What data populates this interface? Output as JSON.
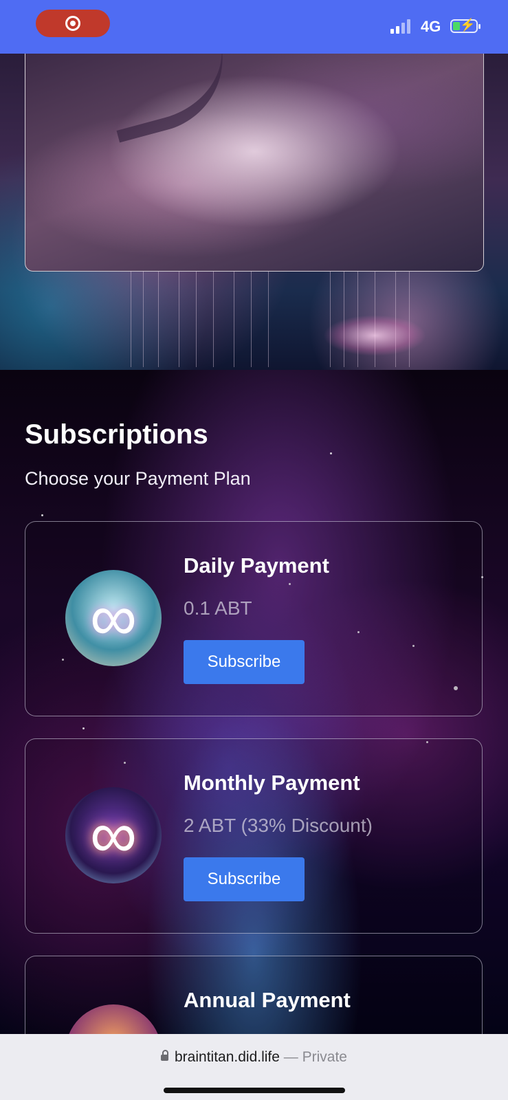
{
  "status_bar": {
    "network": "4G",
    "signal_bars": 2,
    "battery_charging": true,
    "record_icon": "record-icon",
    "battery_icon": "battery-charging-icon"
  },
  "subscriptions": {
    "title": "Subscriptions",
    "subtitle": "Choose your Payment Plan",
    "plans": [
      {
        "name": "Daily Payment",
        "price": "0.1 ABT",
        "button": "Subscribe",
        "icon": "infinity-icon"
      },
      {
        "name": "Monthly Payment",
        "price": "2 ABT (33% Discount)",
        "button": "Subscribe",
        "icon": "infinity-icon"
      },
      {
        "name": "Annual Payment",
        "price": "",
        "button": "",
        "icon": "infinity-icon"
      }
    ]
  },
  "browser": {
    "url": "braintitan.did.life",
    "separator": "—",
    "privacy": "Private",
    "lock_icon": "lock-icon"
  },
  "colors": {
    "status_bar": "#4f6cf3",
    "record_pill": "#c0392b",
    "subscribe_button": "#3b79ec",
    "url_bar": "#ececf1"
  }
}
